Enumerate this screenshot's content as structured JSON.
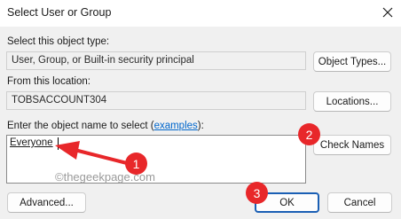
{
  "window": {
    "title": "Select User or Group"
  },
  "object_type": {
    "label": "Select this object type:",
    "value": "User, Group, or Built-in security principal",
    "button": "Object Types..."
  },
  "location": {
    "label": "From this location:",
    "value": "TOBSACCOUNT304",
    "button": "Locations..."
  },
  "names": {
    "label": "Enter the object name to select (",
    "link": "examples",
    "label_end": "):",
    "entered": "Everyone",
    "check_button": "Check Names"
  },
  "footer": {
    "advanced": "Advanced...",
    "ok": "OK",
    "cancel": "Cancel"
  },
  "annotations": {
    "badge_1": "1",
    "badge_2": "2",
    "badge_3": "3",
    "watermark": "©thegeekpage.com",
    "color": "#e8272a"
  },
  "icons": {
    "close": "close-icon"
  }
}
